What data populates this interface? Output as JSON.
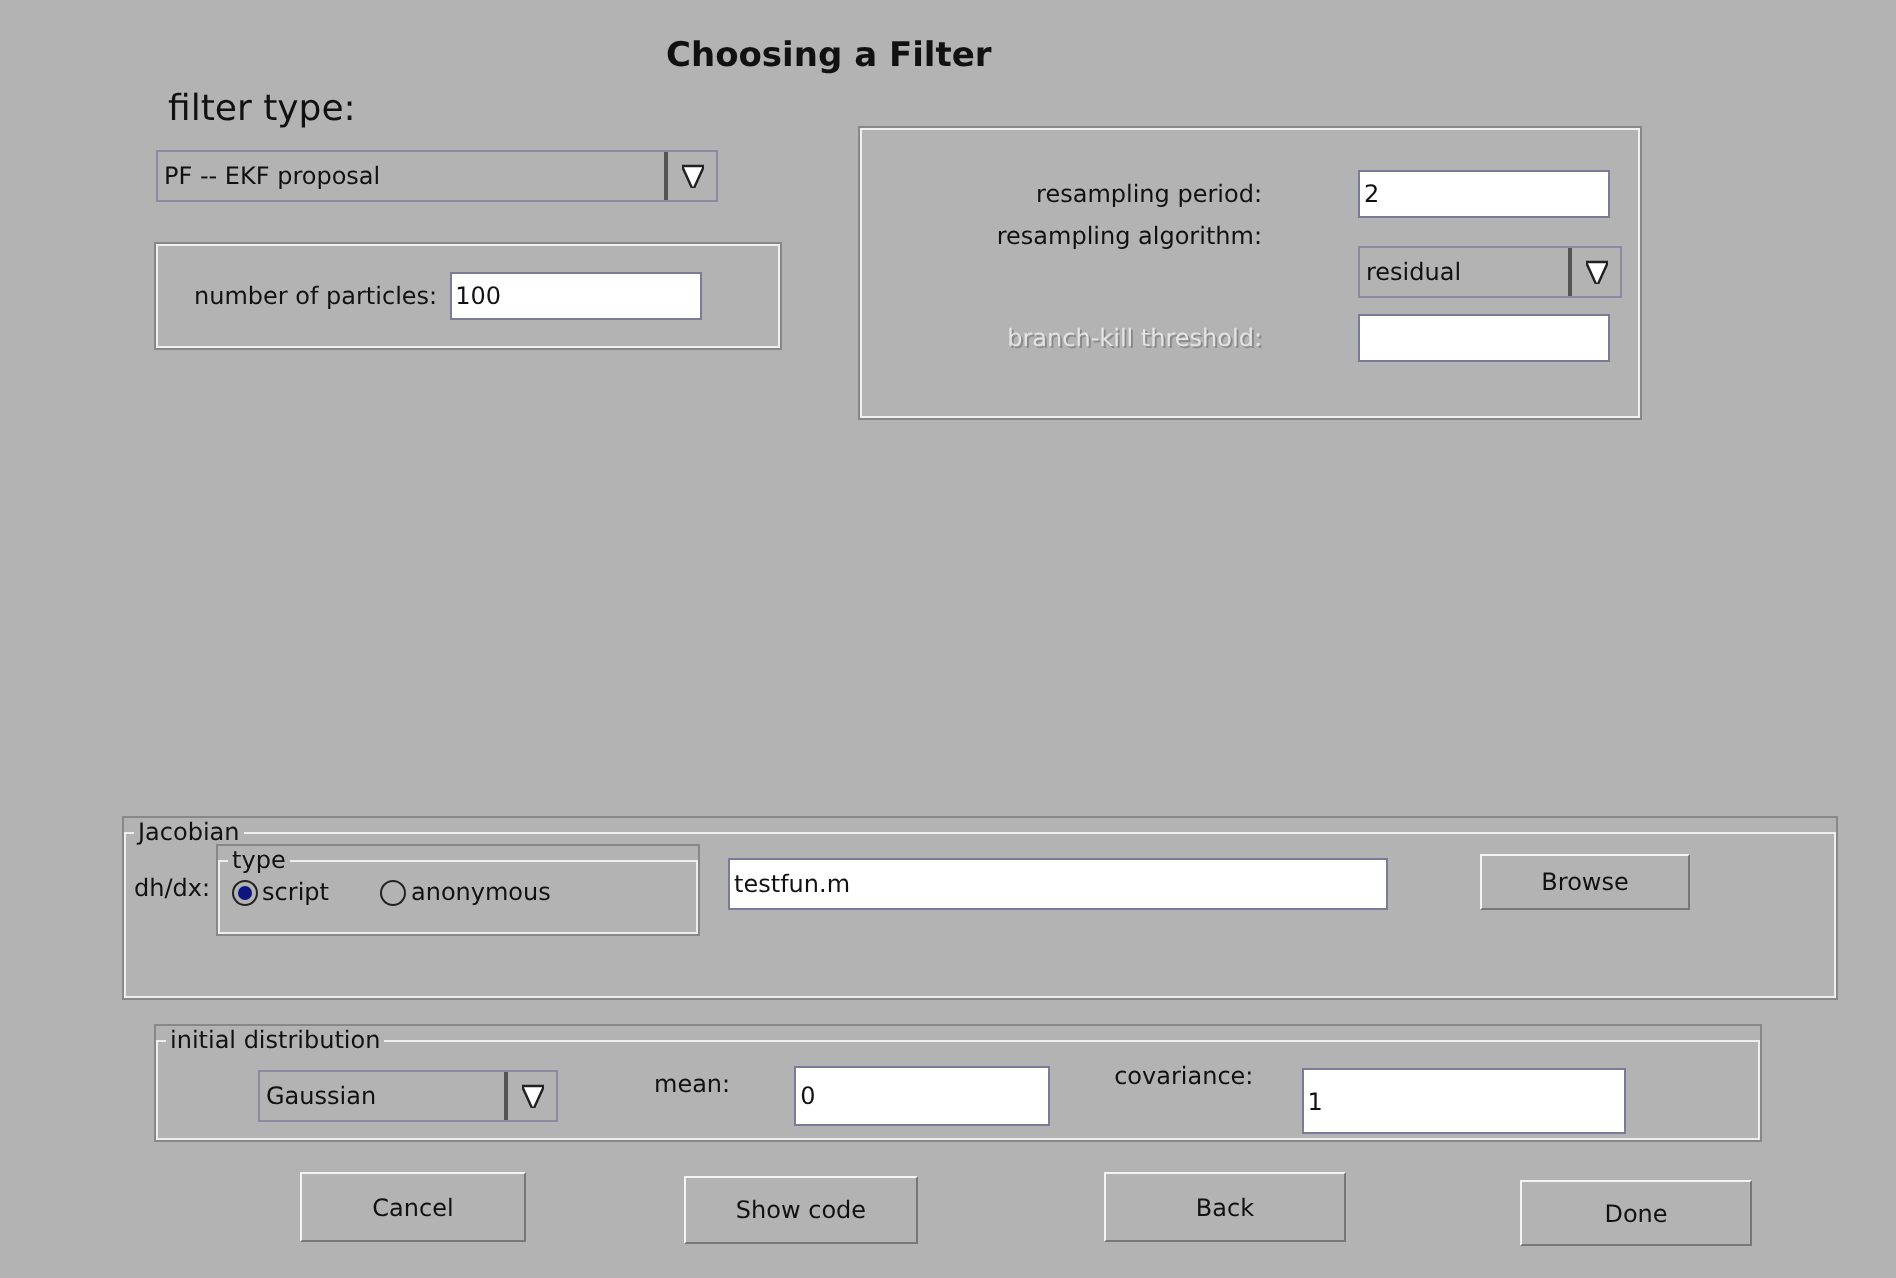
{
  "title": "Choosing a Filter",
  "filter_type": {
    "label": "filter type:",
    "value": "PF -- EKF proposal"
  },
  "particles": {
    "label": "number of particles:",
    "value": "100"
  },
  "resampling": [
    {
      "kind": "text",
      "label": "resampling period:",
      "value": "2",
      "disabled": false
    },
    {
      "kind": "dropdown",
      "label": "resampling algorithm:",
      "value": "residual",
      "disabled": false
    },
    {
      "kind": "text",
      "label": "branch-kill threshold:",
      "disabled": true
    }
  ],
  "jacobian": {
    "title": "Jacobian",
    "label": "dh/dx:",
    "type_title": "type",
    "options": [
      {
        "label": "script",
        "selected": true
      },
      {
        "label": "anonymous",
        "selected": false
      }
    ],
    "value": "testfun.m",
    "browse": "Browse"
  },
  "initial_distribution": {
    "title": "initial distribution",
    "distribution": "Gaussian",
    "mean_label": "mean:",
    "mean": "0",
    "covariance_label": "covariance:",
    "covariance": "1"
  },
  "buttons": [
    "Cancel",
    "Show code",
    "Back",
    "Done"
  ]
}
